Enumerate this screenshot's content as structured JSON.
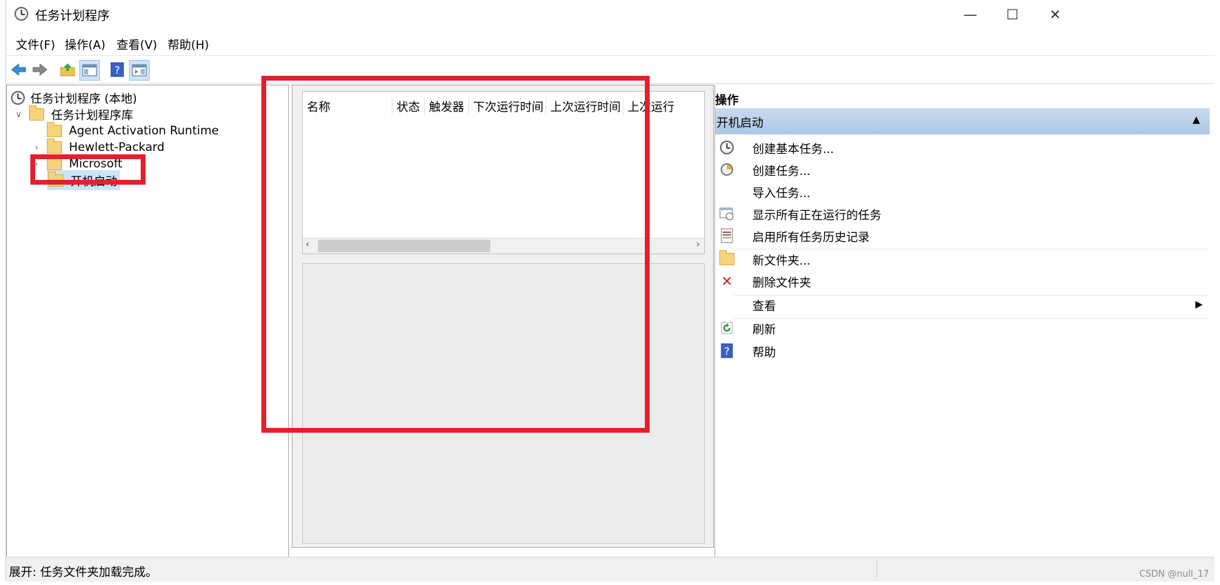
{
  "window": {
    "title": "任务计划程序"
  },
  "menu": [
    "文件(F)",
    "操作(A)",
    "查看(V)",
    "帮助(H)"
  ],
  "tree": {
    "root": "任务计划程序 (本地)",
    "library": "任务计划程序库",
    "items": [
      "Agent Activation Runtime",
      "Hewlett-Packard",
      "Microsoft",
      "开机启动"
    ]
  },
  "list": {
    "columns": [
      "名称",
      "状态",
      "触发器",
      "下次运行时间",
      "上次运行时间",
      "上次运行"
    ]
  },
  "actions": {
    "header": "操作",
    "group": "开机启动",
    "items": [
      "创建基本任务...",
      "创建任务...",
      "导入任务...",
      "显示所有正在运行的任务",
      "启用所有任务历史记录",
      "新文件夹...",
      "删除文件夹",
      "查看",
      "刷新",
      "帮助"
    ]
  },
  "status": {
    "text": "展开: 任务文件夹加载完成。"
  },
  "watermark": "CSDN @null_17",
  "colors": {
    "annotation": "#e5202e",
    "selection": "#cce4f7",
    "action_group": "#b8cfe9"
  }
}
